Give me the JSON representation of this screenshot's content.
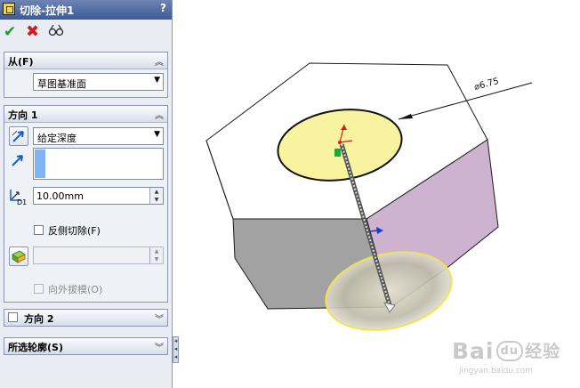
{
  "feature_panel": {
    "title": "切除-拉伸1",
    "help": "?",
    "actions": {
      "ok": "✔",
      "cancel": "✖",
      "preview": "66"
    },
    "from": {
      "title": "从(F)",
      "selected": "草图基准面"
    },
    "direction1": {
      "title": "方向 1",
      "end_condition": "给定深度",
      "depth": "10.00mm",
      "depth_icon_label": "D1",
      "flip_side_cut": "反侧切除(F)",
      "draft_outward": "向外拔模(O)"
    },
    "direction2": {
      "title": "方向 2"
    },
    "selected_contours": {
      "title": "所选轮廓(S)"
    }
  },
  "viewport": {
    "dimension_label": "⌀6.75"
  },
  "watermark": {
    "main": "Bai",
    "badge": "du",
    "suffix": "经验",
    "sub": "jingyan.baidu.com"
  },
  "colors": {
    "panel_bg": "#e9ecf2",
    "title_bar": "#3c5a96",
    "ok": "#1f9a2a",
    "cancel": "#d51d1d",
    "face_pink": "#cdb3cf",
    "face_gray": "#a2a2a2",
    "hole_fill": "#f8f39e"
  }
}
